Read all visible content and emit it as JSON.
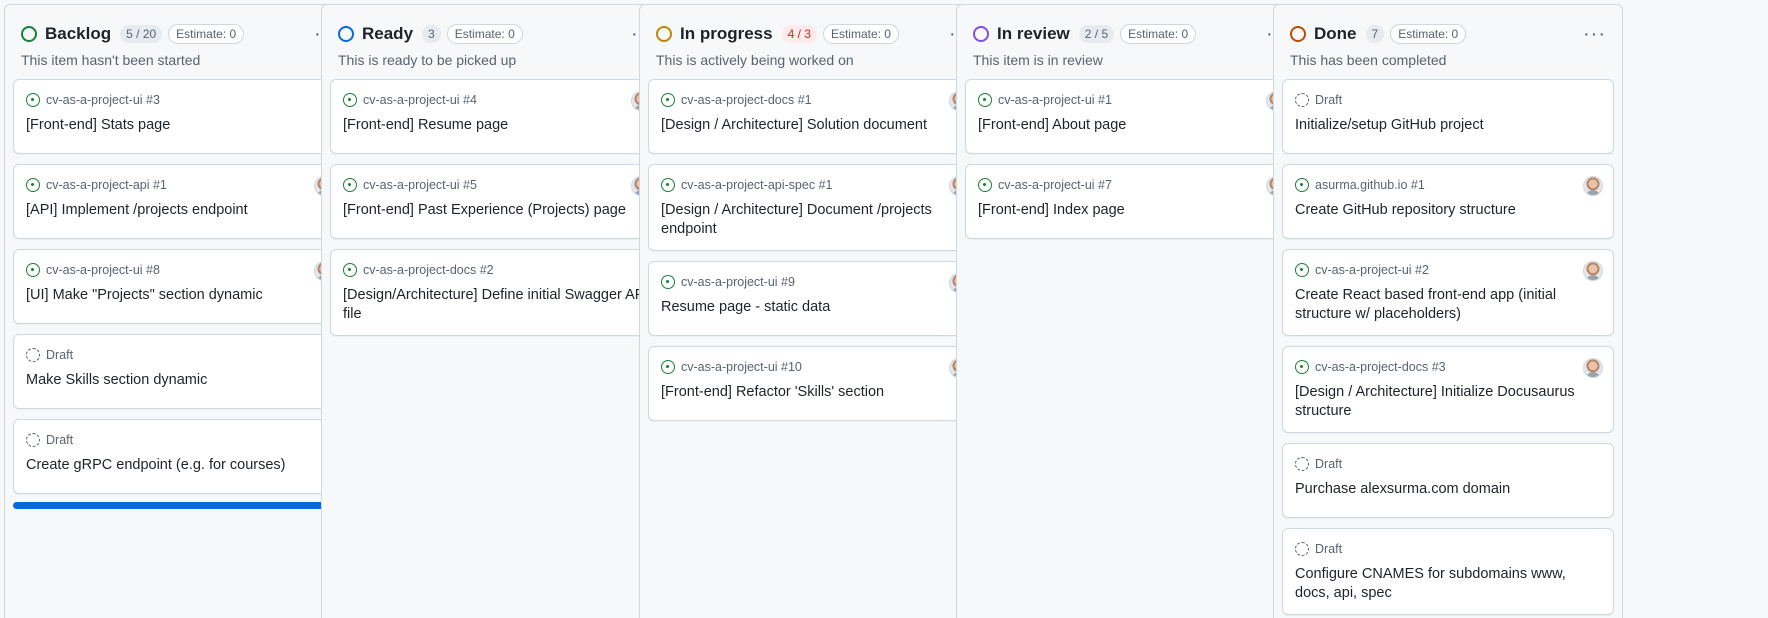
{
  "columns": [
    {
      "title": "Backlog",
      "color": "#1a7f37",
      "count": "5 / 20",
      "count_over": false,
      "estimate": "Estimate: 0",
      "description": "This item hasn't been started",
      "cards": [
        {
          "type": "issue",
          "ref": "cv-as-a-project-ui #3",
          "title": "[Front-end] Stats page",
          "avatar": false
        },
        {
          "type": "issue",
          "ref": "cv-as-a-project-api #1",
          "title": "[API] Implement /projects endpoint",
          "avatar": true
        },
        {
          "type": "issue",
          "ref": "cv-as-a-project-ui #8",
          "title": "[UI] Make \"Projects\" section dynamic",
          "avatar": true
        },
        {
          "type": "draft",
          "ref": "Draft",
          "title": "Make Skills section dynamic",
          "avatar": false
        },
        {
          "type": "draft",
          "ref": "Draft",
          "title": "Create gRPC endpoint (e.g. for courses)",
          "avatar": false
        }
      ]
    },
    {
      "title": "Ready",
      "color": "#0969da",
      "count": "3",
      "count_over": false,
      "estimate": "Estimate: 0",
      "description": "This is ready to be picked up",
      "cards": [
        {
          "type": "issue",
          "ref": "cv-as-a-project-ui #4",
          "title": "[Front-end] Resume page",
          "avatar": true
        },
        {
          "type": "issue",
          "ref": "cv-as-a-project-ui #5",
          "title": "[Front-end] Past Experience (Projects) page",
          "avatar": true
        },
        {
          "type": "issue",
          "ref": "cv-as-a-project-docs #2",
          "title": "[Design/Architecture] Define initial Swagger API file",
          "avatar": false
        }
      ]
    },
    {
      "title": "In progress",
      "color": "#bf8700",
      "count": "4 / 3",
      "count_over": true,
      "estimate": "Estimate: 0",
      "description": "This is actively being worked on",
      "cards": [
        {
          "type": "issue",
          "ref": "cv-as-a-project-docs #1",
          "title": "[Design / Architecture] Solution document",
          "avatar": true
        },
        {
          "type": "issue",
          "ref": "cv-as-a-project-api-spec #1",
          "title": "[Design / Architecture] Document /projects endpoint",
          "avatar": true
        },
        {
          "type": "issue",
          "ref": "cv-as-a-project-ui #9",
          "title": "Resume page - static data",
          "avatar": true
        },
        {
          "type": "issue",
          "ref": "cv-as-a-project-ui #10",
          "title": "[Front-end] Refactor 'Skills' section",
          "avatar": true
        }
      ]
    },
    {
      "title": "In review",
      "color": "#8250df",
      "count": "2 / 5",
      "count_over": false,
      "estimate": "Estimate: 0",
      "description": "This item is in review",
      "cards": [
        {
          "type": "issue",
          "ref": "cv-as-a-project-ui #1",
          "title": "[Front-end] About page",
          "avatar": true
        },
        {
          "type": "issue",
          "ref": "cv-as-a-project-ui #7",
          "title": "[Front-end] Index page",
          "avatar": true
        }
      ]
    },
    {
      "title": "Done",
      "color": "#bc4c00",
      "count": "7",
      "count_over": false,
      "estimate": "Estimate: 0",
      "description": "This has been completed",
      "cards": [
        {
          "type": "draft",
          "ref": "Draft",
          "title": "Initialize/setup GitHub project",
          "avatar": false
        },
        {
          "type": "issue",
          "ref": "asurma.github.io #1",
          "title": "Create GitHub repository structure",
          "avatar": true
        },
        {
          "type": "issue",
          "ref": "cv-as-a-project-ui #2",
          "title": "Create React based front-end app (initial structure w/ placeholders)",
          "avatar": true
        },
        {
          "type": "issue",
          "ref": "cv-as-a-project-docs #3",
          "title": "[Design / Architecture] Initialize Docusaurus structure",
          "avatar": true
        },
        {
          "type": "draft",
          "ref": "Draft",
          "title": "Purchase alexsurma.com domain",
          "avatar": false
        },
        {
          "type": "draft",
          "ref": "Draft",
          "title": "Configure CNAMES for subdomains www, docs, api, spec",
          "avatar": false
        }
      ]
    }
  ],
  "menu_glyph": "···",
  "drop_indicator_column": 0
}
